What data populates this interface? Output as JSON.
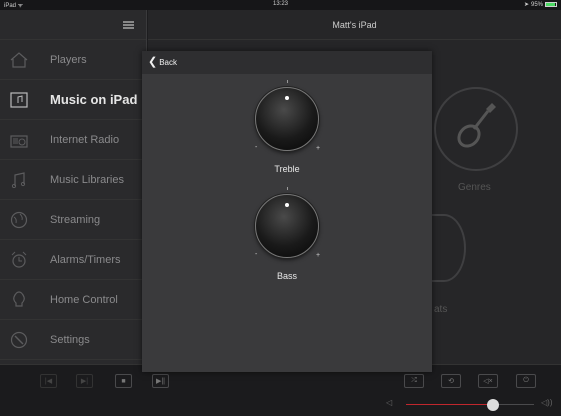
{
  "status": {
    "left": "iPad ᯤ",
    "time": "13:23",
    "battery": "95%"
  },
  "header": {
    "title": "Matt's iPad"
  },
  "sidebar": {
    "items": [
      {
        "label": "Players",
        "icon": "house-icon"
      },
      {
        "label": "Music on iPad",
        "icon": "music-note-icon",
        "active": true
      },
      {
        "label": "Internet Radio",
        "icon": "radio-icon"
      },
      {
        "label": "Music Libraries",
        "icon": "music-library-icon"
      },
      {
        "label": "Streaming",
        "icon": "globe-icon"
      },
      {
        "label": "Alarms/Timers",
        "icon": "alarm-clock-icon"
      },
      {
        "label": "Home Control",
        "icon": "lightbulb-icon"
      },
      {
        "label": "Settings",
        "icon": "settings-icon"
      }
    ]
  },
  "background_tiles": {
    "genres_label": "Genres",
    "tile2_label": "ats"
  },
  "panel": {
    "back_label": "Back",
    "treble": {
      "label": "Treble",
      "minus": "-",
      "plus": "+",
      "value": 0
    },
    "bass": {
      "label": "Bass",
      "minus": "-",
      "plus": "+",
      "value": 0
    }
  },
  "transport": {
    "buttons": [
      "previous-icon",
      "next-icon",
      "stop-icon",
      "play-pause-icon"
    ],
    "right_buttons": [
      "shuffle-icon",
      "repeat-icon",
      "mute-icon",
      "power-icon"
    ]
  },
  "volume": {
    "level": 0.68,
    "accent": "#c0272d"
  }
}
